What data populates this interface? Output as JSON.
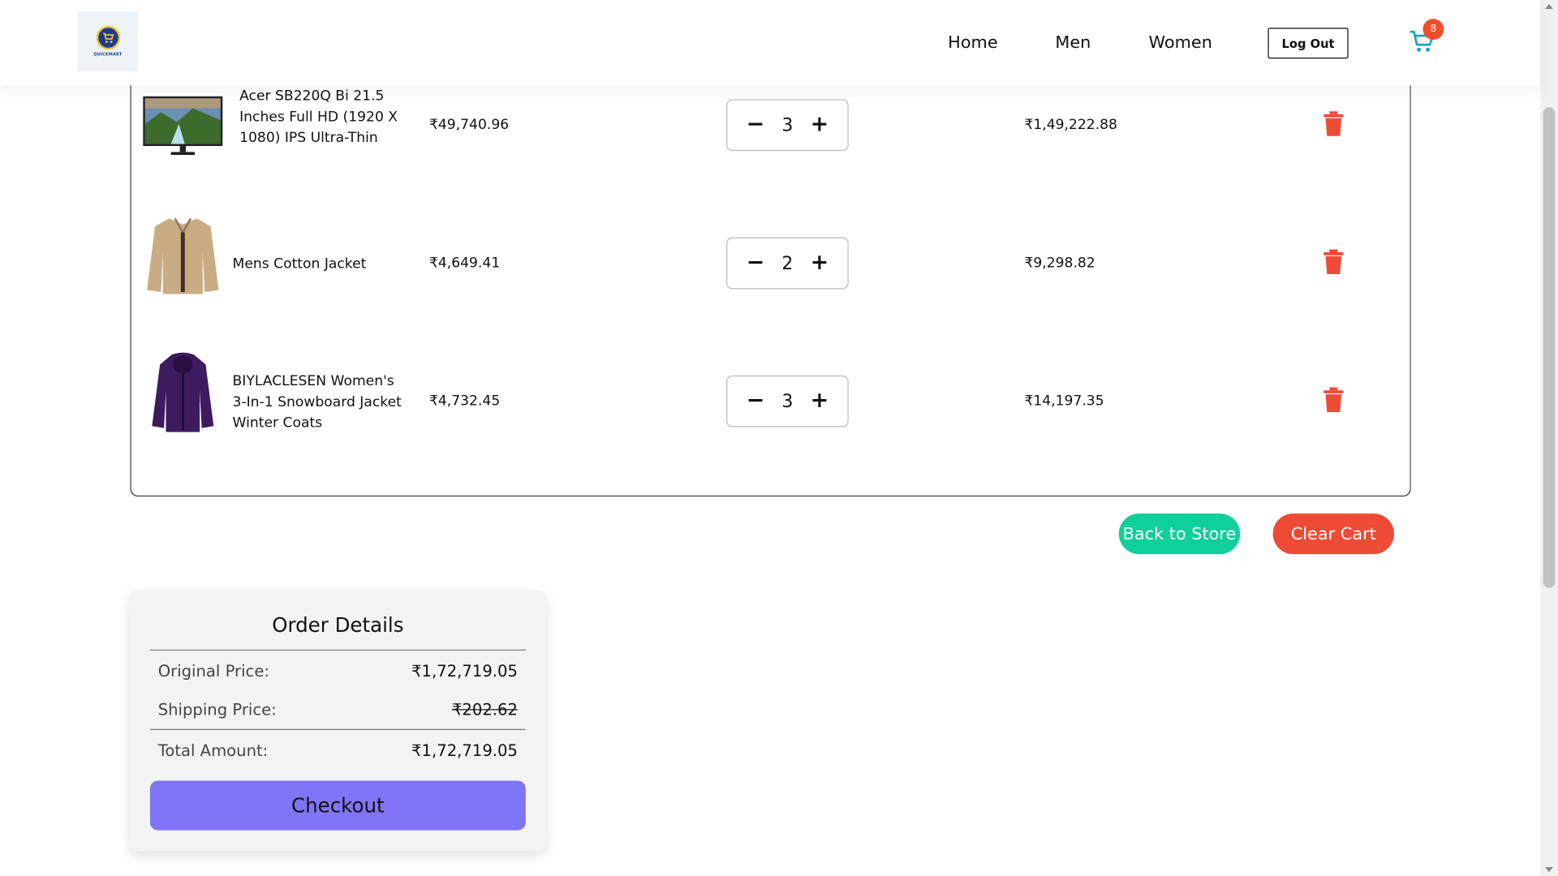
{
  "header": {
    "logo_text": "QUICKMART",
    "nav": [
      "Home",
      "Men",
      "Women"
    ],
    "logout_label": "Log Out",
    "cart_count": "8"
  },
  "cart": {
    "items": [
      {
        "name": "Acer SB220Q Bi 21.5 Inches Full HD (1920 X 1080) IPS Ultra-Thin",
        "price": "₹49,740.96",
        "qty": "3",
        "subtotal": "₹1,49,222.88",
        "image": "monitor"
      },
      {
        "name": "Mens Cotton Jacket",
        "price": "₹4,649.41",
        "qty": "2",
        "subtotal": "₹9,298.82",
        "image": "jacket-beige"
      },
      {
        "name": "BIYLACLESEN Women's 3-In-1 Snowboard Jacket Winter Coats",
        "price": "₹4,732.45",
        "qty": "3",
        "subtotal": "₹14,197.35",
        "image": "jacket-purple"
      }
    ],
    "qty_minus": "−",
    "qty_plus": "+"
  },
  "actions": {
    "back_label": "Back to Store",
    "clear_label": "Clear Cart"
  },
  "order": {
    "title": "Order Details",
    "original_label": "Original Price:",
    "original_value": "₹1,72,719.05",
    "shipping_label": "Shipping Price:",
    "shipping_value": "₹202.62",
    "total_label": "Total Amount:",
    "total_value": "₹1,72,719.05",
    "checkout_label": "Checkout"
  },
  "colors": {
    "accent_teal": "#0fcf9c",
    "danger": "#ee4b36",
    "checkout": "#8075f7",
    "badge": "#f24c2c",
    "cart_icon": "#17a2b8"
  }
}
